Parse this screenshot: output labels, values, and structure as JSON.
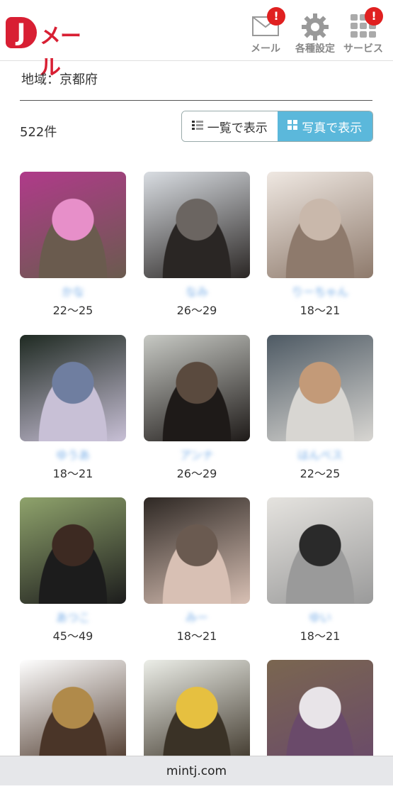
{
  "header": {
    "logo_text": "メール",
    "logo_letter": "J",
    "icons": [
      {
        "name": "mail-icon",
        "label": "メール",
        "badge": "!"
      },
      {
        "name": "gear-icon",
        "label": "各種設定"
      },
      {
        "name": "grid-icon",
        "label": "サービス",
        "badge": "!"
      }
    ]
  },
  "region_label": "地域：京都府",
  "count": "522件",
  "view_toggle": {
    "list_label": "一覧で表示",
    "photo_label": "写真で表示",
    "active": "photo",
    "accent_color": "#5bb8db"
  },
  "profiles": [
    {
      "name": "かな",
      "age": "22〜25",
      "colors": [
        "#b03a8a",
        "#e78fc9",
        "#6a5b4e"
      ]
    },
    {
      "name": "なみ",
      "age": "26〜29",
      "colors": [
        "#d9dde2",
        "#6b6561",
        "#2a2624"
      ]
    },
    {
      "name": "りーちゃん",
      "age": "18〜21",
      "colors": [
        "#efe8e2",
        "#c9b8ab",
        "#8e7a6c"
      ]
    },
    {
      "name": "ゆうあ",
      "age": "18〜21",
      "colors": [
        "#1f2a22",
        "#6f7ea0",
        "#c8c0d6"
      ]
    },
    {
      "name": "アンナ",
      "age": "26〜29",
      "colors": [
        "#c7c9c4",
        "#5a4a3e",
        "#1e1a18"
      ]
    },
    {
      "name": "はんべス",
      "age": "22〜25",
      "colors": [
        "#4e5a64",
        "#c39a78",
        "#d8d6d2"
      ]
    },
    {
      "name": "あつこ",
      "age": "45〜49",
      "colors": [
        "#8fa36c",
        "#3d2a22",
        "#1c1c1c"
      ]
    },
    {
      "name": "みー",
      "age": "18〜21",
      "colors": [
        "#2e2824",
        "#6a5a50",
        "#d8c0b4"
      ]
    },
    {
      "name": "ゆい",
      "age": "18〜21",
      "colors": [
        "#e5e3df",
        "#2a2a2a",
        "#9a9a9a"
      ]
    },
    {
      "name": "",
      "age": "",
      "colors": [
        "#fff",
        "#b08a4a",
        "#4a3528"
      ]
    },
    {
      "name": "",
      "age": "",
      "colors": [
        "#eceee8",
        "#e6c040",
        "#3a3226"
      ]
    },
    {
      "name": "",
      "age": "",
      "colors": [
        "#7a6650",
        "#e8e4e8",
        "#6a4a6a"
      ]
    }
  ],
  "footer_domain": "mintj.com"
}
